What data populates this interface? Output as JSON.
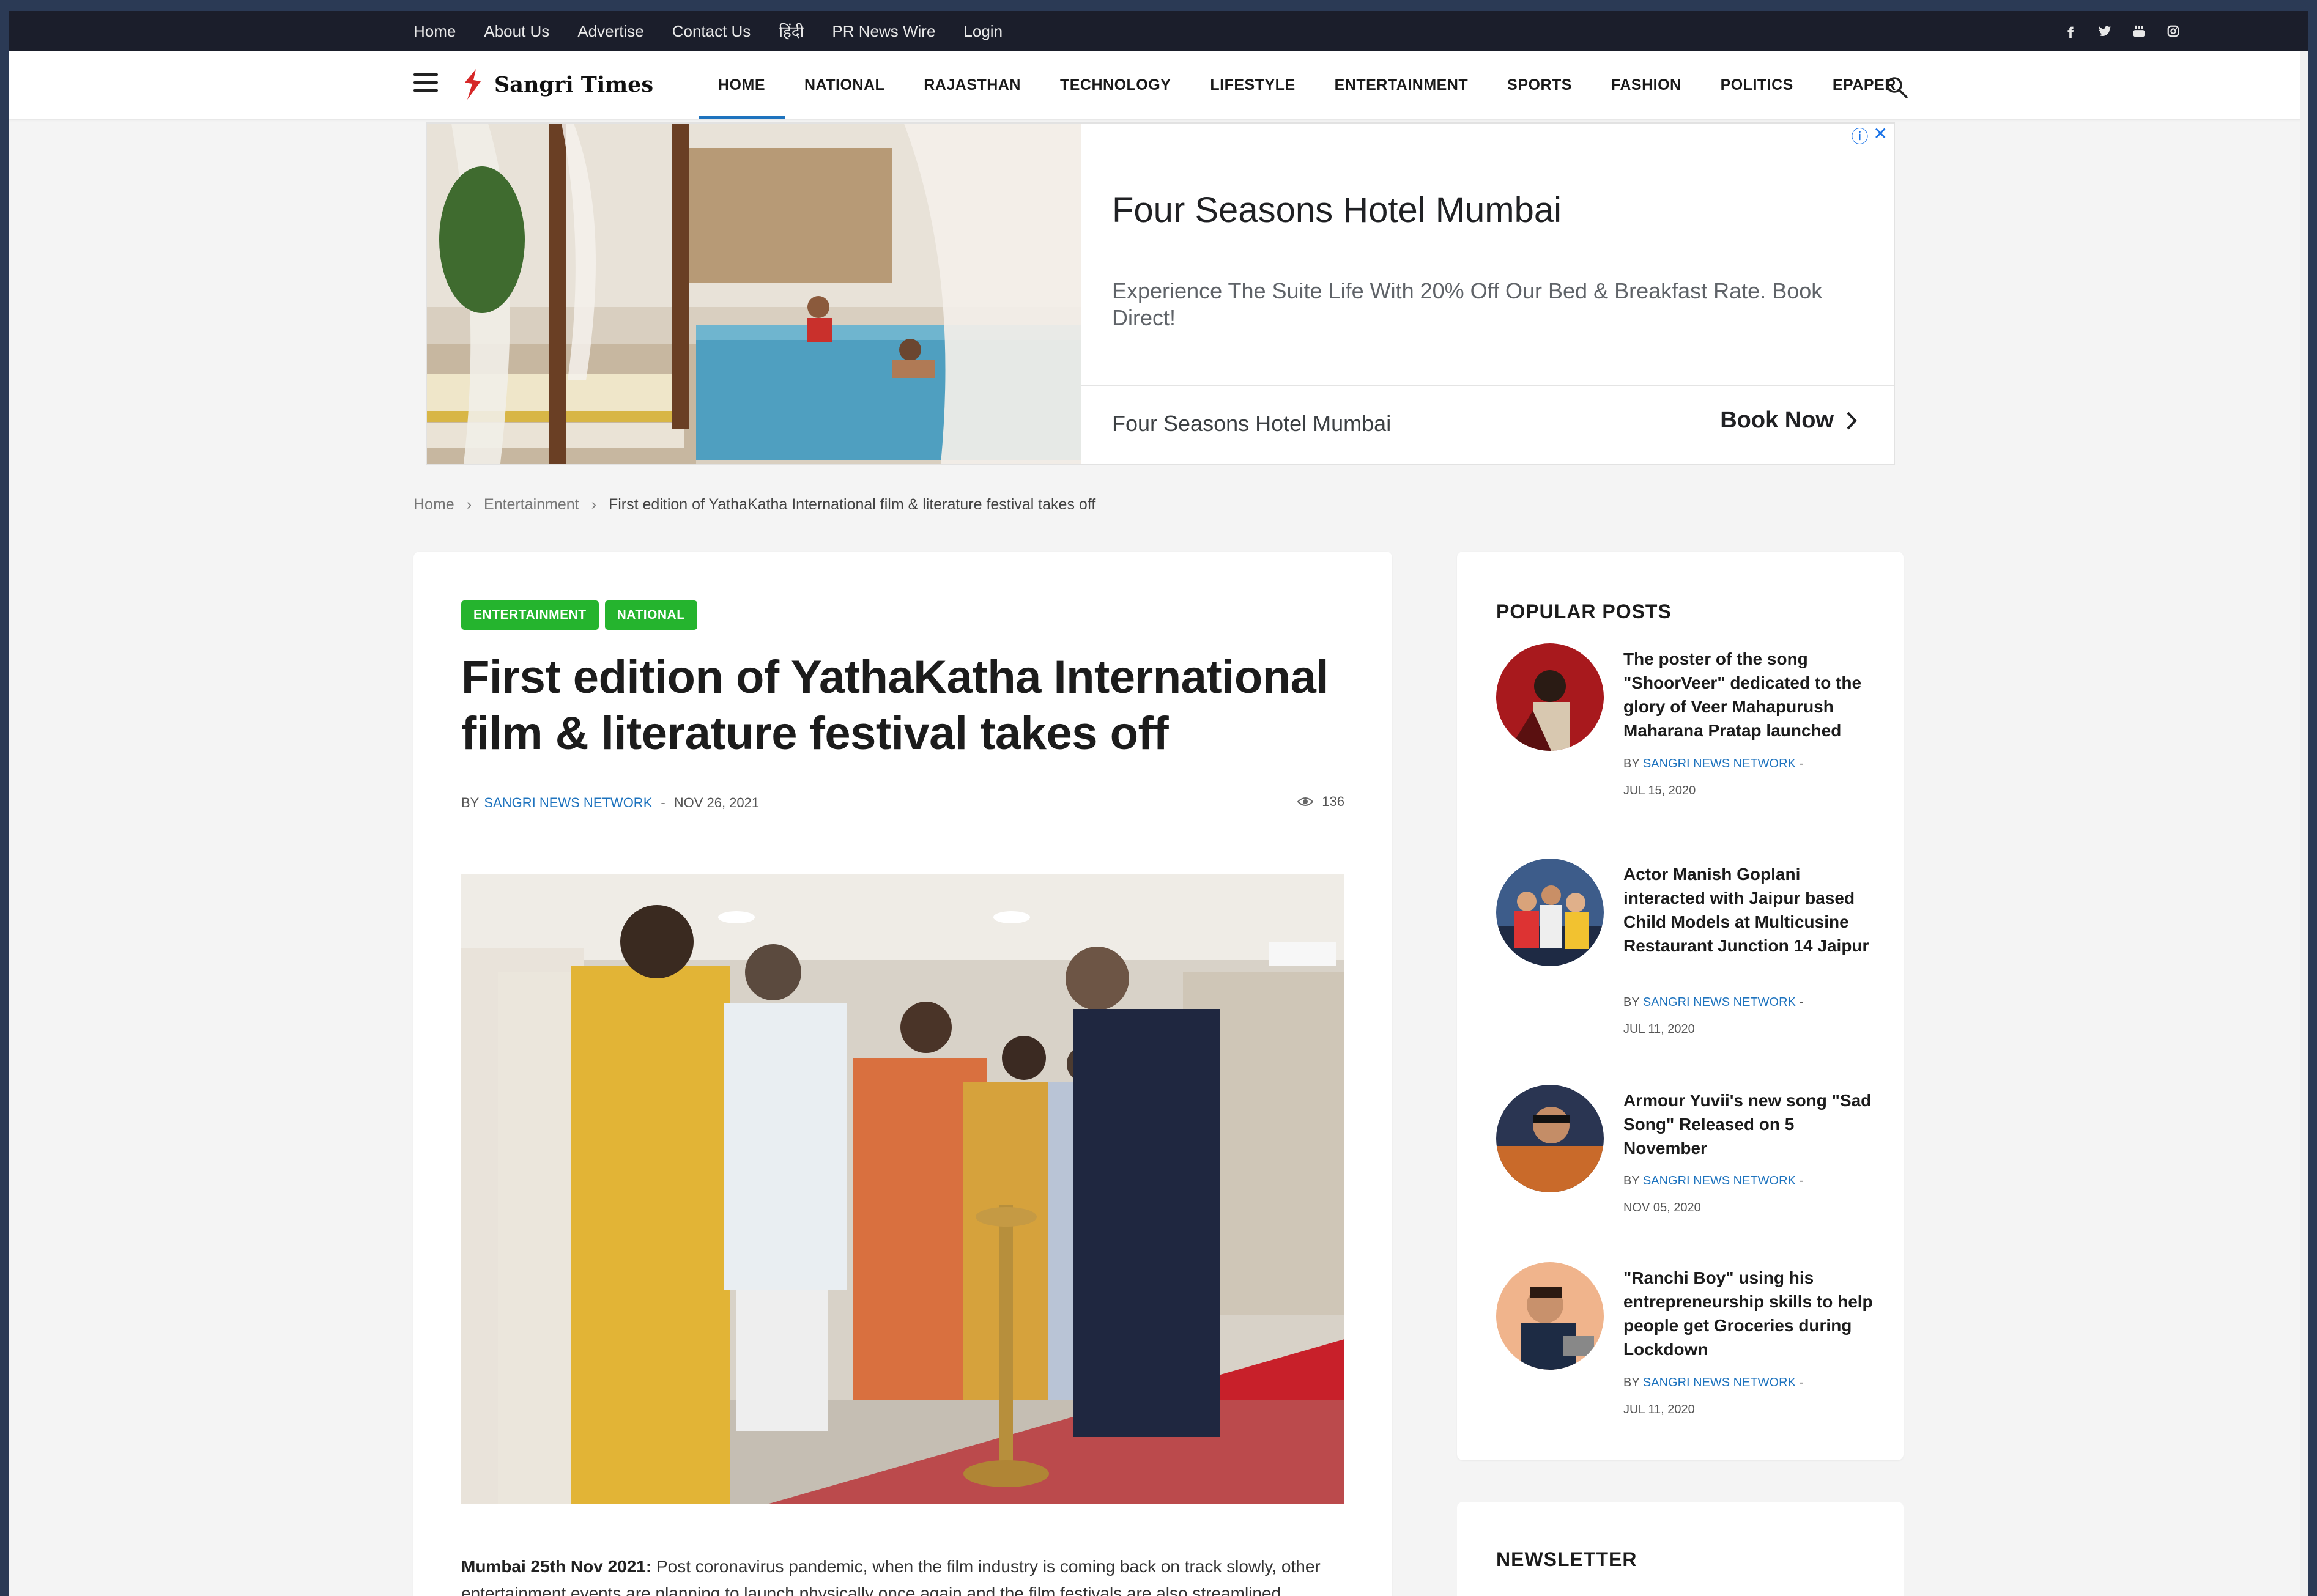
{
  "topbar": {
    "links": [
      "Home",
      "About Us",
      "Advertise",
      "Contact Us",
      "हिंदी",
      "PR News Wire",
      "Login"
    ],
    "social_icons": [
      "facebook-icon",
      "twitter-icon",
      "youtube-icon",
      "instagram-icon"
    ]
  },
  "nav": {
    "logo_text": "Sangri Times",
    "items": [
      "HOME",
      "NATIONAL",
      "RAJASTHAN",
      "TECHNOLOGY",
      "LIFESTYLE",
      "ENTERTAINMENT",
      "SPORTS",
      "FASHION",
      "POLITICS",
      "EPAPER"
    ],
    "active_item": "HOME",
    "accent_color": "#1e73be"
  },
  "ad": {
    "headline": "Four Seasons Hotel Mumbai",
    "description": "Experience The Suite Life With 20% Off Our Bed & Breakfast Rate. Book Direct!",
    "advertiser": "Four Seasons Hotel Mumbai",
    "cta": "Book Now"
  },
  "breadcrumb": {
    "items": [
      "Home",
      "Entertainment"
    ],
    "current": "First edition of YathaKatha International film & literature festival takes off"
  },
  "article": {
    "tags": [
      "ENTERTAINMENT",
      "NATIONAL"
    ],
    "tag_color": "#25b42e",
    "title": "First edition of YathaKatha International film & literature festival takes off",
    "by_label": "BY",
    "author": "SANGRI NEWS NETWORK",
    "date": "NOV 26, 2021",
    "views": "136",
    "lead_bold": "Mumbai 25th Nov 2021:",
    "lead_text": "Post coronavirus pandemic, when the film industry is coming back on track slowly, other entertainment events are planning to launch physically once again and the film festivals are also streamlined."
  },
  "sidebar": {
    "popular_title": "POPULAR POSTS",
    "posts": [
      {
        "title": "The poster of the song \"ShoorVeer\" dedicated to the glory of Veer Mahapurush Maharana Pratap launched",
        "by_label": "BY",
        "author": "SANGRI NEWS NETWORK",
        "date": "JUL 15, 2020"
      },
      {
        "title": "Actor Manish Goplani interacted with Jaipur based Child Models at Multicusine Restaurant Junction 14 Jaipur",
        "by_label": "BY",
        "author": "SANGRI NEWS NETWORK",
        "date": "JUL 11, 2020"
      },
      {
        "title": "Armour Yuvii's new song \"Sad Song\" Released on 5 November",
        "by_label": "BY",
        "author": "SANGRI NEWS NETWORK",
        "date": "NOV 05, 2020"
      },
      {
        "title": "\"Ranchi Boy\" using his entrepreneurship skills to help people get Groceries during Lockdown",
        "by_label": "BY",
        "author": "SANGRI NEWS NETWORK",
        "date": "JUL 11, 2020"
      }
    ],
    "newsletter_title": "NEWSLETTER"
  }
}
